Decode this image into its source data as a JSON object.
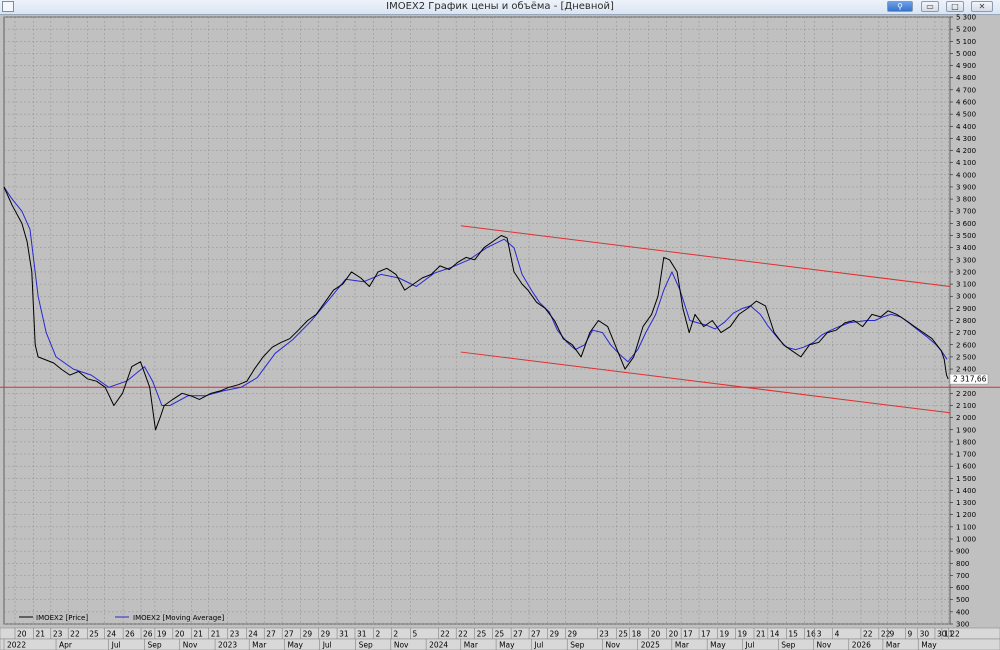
{
  "window": {
    "title": "IMOEX2 График цены и объёма - [Дневной]"
  },
  "colors": {
    "plot_bg": "#c0c0c0",
    "grid": "#8f8f8f",
    "price": "#000000",
    "moving_average": "#2828d0",
    "trendline": "#e03030",
    "support": "#e03030"
  },
  "chart_data": {
    "type": "line",
    "title": "",
    "xlabel": "",
    "ylabel": "",
    "ylim": [
      300,
      5300
    ],
    "y_tick_step": 100,
    "x_range": [
      "2022-01-01",
      "2026-06-25"
    ],
    "grid": true,
    "legend_position": "bottom-left",
    "legend": [
      {
        "name": "IMOEX2 [Price]",
        "color": "#000000"
      },
      {
        "name": "IMOEX2 [Moving Average]",
        "color": "#2828d0"
      }
    ],
    "last_price_label": "2 317,66",
    "x_day_ticks": [
      {
        "date": "2022-01-20",
        "label": "20"
      },
      {
        "date": "2022-02-21",
        "label": "21"
      },
      {
        "date": "2022-03-23",
        "label": "23"
      },
      {
        "date": "2022-04-22",
        "label": "22"
      },
      {
        "date": "2022-05-25",
        "label": "25"
      },
      {
        "date": "2022-06-24",
        "label": "24"
      },
      {
        "date": "2022-07-26",
        "label": "26"
      },
      {
        "date": "2022-08-26",
        "label": "26"
      },
      {
        "date": "2022-09-19",
        "label": "19"
      },
      {
        "date": "2022-10-20",
        "label": "20"
      },
      {
        "date": "2022-11-21",
        "label": "21"
      },
      {
        "date": "2022-12-21",
        "label": "21"
      },
      {
        "date": "2023-01-23",
        "label": "23"
      },
      {
        "date": "2023-02-24",
        "label": "24"
      },
      {
        "date": "2023-03-27",
        "label": "27"
      },
      {
        "date": "2023-04-27",
        "label": "27"
      },
      {
        "date": "2023-05-29",
        "label": "29"
      },
      {
        "date": "2023-06-29",
        "label": "29"
      },
      {
        "date": "2023-07-31",
        "label": "31"
      },
      {
        "date": "2023-08-31",
        "label": "31"
      },
      {
        "date": "2023-10-02",
        "label": "2"
      },
      {
        "date": "2023-11-02",
        "label": "2"
      },
      {
        "date": "2023-12-05",
        "label": "5"
      },
      {
        "date": "2024-01-22",
        "label": "22"
      },
      {
        "date": "2024-02-22",
        "label": "22"
      },
      {
        "date": "2024-03-25",
        "label": "25"
      },
      {
        "date": "2024-04-25",
        "label": "25"
      },
      {
        "date": "2024-05-27",
        "label": "27"
      },
      {
        "date": "2024-06-27",
        "label": "27"
      },
      {
        "date": "2024-07-29",
        "label": "29"
      },
      {
        "date": "2024-08-29",
        "label": "29"
      },
      {
        "date": "2024-10-23",
        "label": "23"
      },
      {
        "date": "2024-11-25",
        "label": "25"
      },
      {
        "date": "2024-12-18",
        "label": "18"
      },
      {
        "date": "2025-01-20",
        "label": "20"
      },
      {
        "date": "2025-02-20",
        "label": "20"
      },
      {
        "date": "2025-03-17",
        "label": "17"
      },
      {
        "date": "2025-04-17",
        "label": "17"
      },
      {
        "date": "2025-05-19",
        "label": "19"
      },
      {
        "date": "2025-06-19",
        "label": "19"
      },
      {
        "date": "2025-07-21",
        "label": "21"
      },
      {
        "date": "2025-08-14",
        "label": "14"
      },
      {
        "date": "2025-09-15",
        "label": "15"
      },
      {
        "date": "2025-10-16",
        "label": "16"
      },
      {
        "date": "2025-11-03",
        "label": "3"
      },
      {
        "date": "2025-12-04",
        "label": "4"
      },
      {
        "date": "2026-01-22",
        "label": "22"
      },
      {
        "date": "2026-02-22",
        "label": "22"
      },
      {
        "date": "2026-03-09",
        "label": "9"
      },
      {
        "date": "2026-04-09",
        "label": "9"
      },
      {
        "date": "2026-04-30",
        "label": "30"
      },
      {
        "date": "2026-05-30",
        "label": "30"
      },
      {
        "date": "2026-06-11",
        "label": "11"
      },
      {
        "date": "2026-06-22",
        "label": "22"
      }
    ],
    "x_month_ticks": [
      {
        "date": "2022-01-01",
        "label": "2022"
      },
      {
        "date": "2022-04-01",
        "label": "Apr"
      },
      {
        "date": "2022-07-01",
        "label": "Jul"
      },
      {
        "date": "2022-09-01",
        "label": "Sep"
      },
      {
        "date": "2022-11-01",
        "label": "Nov"
      },
      {
        "date": "2023-01-01",
        "label": "2023"
      },
      {
        "date": "2023-03-01",
        "label": "Mar"
      },
      {
        "date": "2023-05-01",
        "label": "May"
      },
      {
        "date": "2023-07-01",
        "label": "Jul"
      },
      {
        "date": "2023-09-01",
        "label": "Sep"
      },
      {
        "date": "2023-11-01",
        "label": "Nov"
      },
      {
        "date": "2024-01-01",
        "label": "2024"
      },
      {
        "date": "2024-03-01",
        "label": "Mar"
      },
      {
        "date": "2024-05-01",
        "label": "May"
      },
      {
        "date": "2024-07-01",
        "label": "Jul"
      },
      {
        "date": "2024-09-01",
        "label": "Sep"
      },
      {
        "date": "2024-11-01",
        "label": "Nov"
      },
      {
        "date": "2025-01-01",
        "label": "2025"
      },
      {
        "date": "2025-03-01",
        "label": "Mar"
      },
      {
        "date": "2025-05-01",
        "label": "May"
      },
      {
        "date": "2025-07-01",
        "label": "Jul"
      },
      {
        "date": "2025-09-01",
        "label": "Sep"
      },
      {
        "date": "2025-11-01",
        "label": "Nov"
      },
      {
        "date": "2026-01-01",
        "label": "2026"
      },
      {
        "date": "2026-03-01",
        "label": "Mar"
      },
      {
        "date": "2026-05-01",
        "label": "May"
      }
    ],
    "price": {
      "x": [
        "2022-01-01",
        "2022-01-15",
        "2022-02-01",
        "2022-02-10",
        "2022-02-18",
        "2022-02-24",
        "2022-03-01",
        "2022-03-28",
        "2022-04-10",
        "2022-04-25",
        "2022-05-10",
        "2022-05-25",
        "2022-06-10",
        "2022-06-25",
        "2022-07-10",
        "2022-07-25",
        "2022-08-10",
        "2022-08-25",
        "2022-09-10",
        "2022-09-20",
        "2022-09-28",
        "2022-10-05",
        "2022-10-20",
        "2022-11-05",
        "2022-11-20",
        "2022-12-05",
        "2022-12-25",
        "2023-01-10",
        "2023-01-25",
        "2023-02-10",
        "2023-02-25",
        "2023-03-10",
        "2023-03-25",
        "2023-04-10",
        "2023-04-25",
        "2023-05-10",
        "2023-05-25",
        "2023-06-10",
        "2023-06-25",
        "2023-07-10",
        "2023-07-25",
        "2023-08-10",
        "2023-08-25",
        "2023-09-10",
        "2023-09-25",
        "2023-10-10",
        "2023-10-25",
        "2023-11-10",
        "2023-11-25",
        "2023-12-10",
        "2023-12-25",
        "2024-01-10",
        "2024-01-25",
        "2024-02-10",
        "2024-02-25",
        "2024-03-10",
        "2024-03-25",
        "2024-04-10",
        "2024-04-25",
        "2024-05-10",
        "2024-05-20",
        "2024-06-01",
        "2024-06-15",
        "2024-06-25",
        "2024-07-10",
        "2024-07-25",
        "2024-08-10",
        "2024-08-25",
        "2024-09-10",
        "2024-09-25",
        "2024-10-10",
        "2024-10-25",
        "2024-11-10",
        "2024-11-27",
        "2024-12-10",
        "2024-12-25",
        "2025-01-10",
        "2025-01-25",
        "2025-02-05",
        "2025-02-15",
        "2025-02-25",
        "2025-03-10",
        "2025-03-20",
        "2025-03-31",
        "2025-04-10",
        "2025-04-25",
        "2025-05-10",
        "2025-05-25",
        "2025-06-10",
        "2025-06-25",
        "2025-07-10",
        "2025-07-25",
        "2025-08-10",
        "2025-08-25",
        "2025-09-10",
        "2025-09-25",
        "2025-10-10",
        "2025-10-25",
        "2025-11-10",
        "2025-11-25",
        "2025-12-10",
        "2025-12-25",
        "2026-01-10",
        "2026-01-25",
        "2026-02-10",
        "2026-02-25",
        "2026-03-10",
        "2026-03-25",
        "2026-04-10",
        "2026-04-25",
        "2026-05-10",
        "2026-05-25",
        "2026-06-10",
        "2026-06-15",
        "2026-06-19",
        "2026-06-22"
      ],
      "y": [
        3900,
        3750,
        3600,
        3450,
        3200,
        2600,
        2500,
        2450,
        2400,
        2350,
        2380,
        2320,
        2300,
        2250,
        2100,
        2200,
        2420,
        2460,
        2250,
        1900,
        2000,
        2100,
        2150,
        2200,
        2180,
        2150,
        2200,
        2220,
        2250,
        2270,
        2300,
        2400,
        2500,
        2580,
        2620,
        2650,
        2720,
        2800,
        2850,
        2950,
        3050,
        3100,
        3200,
        3150,
        3080,
        3200,
        3230,
        3180,
        3050,
        3100,
        3150,
        3180,
        3250,
        3220,
        3280,
        3320,
        3300,
        3400,
        3450,
        3500,
        3480,
        3200,
        3100,
        3050,
        2950,
        2900,
        2800,
        2650,
        2600,
        2500,
        2700,
        2800,
        2750,
        2550,
        2400,
        2500,
        2750,
        2850,
        3000,
        3320,
        3300,
        3200,
        2900,
        2700,
        2850,
        2750,
        2800,
        2700,
        2750,
        2850,
        2900,
        2960,
        2920,
        2700,
        2600,
        2550,
        2500,
        2600,
        2620,
        2700,
        2720,
        2780,
        2800,
        2750,
        2850,
        2830,
        2880,
        2850,
        2800,
        2750,
        2700,
        2650,
        2550,
        2480,
        2350,
        2317.66
      ]
    },
    "moving_average": {
      "x": [
        "2022-01-01",
        "2022-01-15",
        "2022-02-01",
        "2022-02-15",
        "2022-03-01",
        "2022-03-15",
        "2022-04-01",
        "2022-05-01",
        "2022-06-01",
        "2022-07-01",
        "2022-08-01",
        "2022-09-01",
        "2022-09-15",
        "2022-10-01",
        "2022-10-15",
        "2022-11-15",
        "2022-12-15",
        "2023-01-15",
        "2023-02-15",
        "2023-03-15",
        "2023-04-15",
        "2023-05-15",
        "2023-06-15",
        "2023-07-15",
        "2023-08-15",
        "2023-09-15",
        "2023-10-15",
        "2023-11-15",
        "2023-12-15",
        "2024-01-15",
        "2024-02-15",
        "2024-03-15",
        "2024-04-15",
        "2024-05-15",
        "2024-06-01",
        "2024-06-15",
        "2024-07-01",
        "2024-07-15",
        "2024-08-01",
        "2024-08-15",
        "2024-09-01",
        "2024-09-15",
        "2024-10-01",
        "2024-10-15",
        "2024-11-01",
        "2024-11-15",
        "2024-12-01",
        "2024-12-15",
        "2025-01-01",
        "2025-01-15",
        "2025-02-01",
        "2025-02-15",
        "2025-03-01",
        "2025-03-15",
        "2025-04-01",
        "2025-04-15",
        "2025-05-01",
        "2025-05-15",
        "2025-06-01",
        "2025-06-15",
        "2025-07-01",
        "2025-07-15",
        "2025-08-01",
        "2025-08-15",
        "2025-09-01",
        "2025-09-15",
        "2025-10-01",
        "2025-10-15",
        "2025-11-01",
        "2025-11-15",
        "2025-12-01",
        "2025-12-15",
        "2026-01-01",
        "2026-01-15",
        "2026-02-01",
        "2026-02-15",
        "2026-03-01",
        "2026-03-15",
        "2026-04-01",
        "2026-04-15",
        "2026-05-01",
        "2026-05-15",
        "2026-06-01",
        "2026-06-10",
        "2026-06-20"
      ],
      "y": [
        3900,
        3800,
        3700,
        3550,
        3000,
        2700,
        2500,
        2400,
        2350,
        2250,
        2300,
        2420,
        2300,
        2100,
        2100,
        2180,
        2180,
        2220,
        2250,
        2330,
        2530,
        2640,
        2790,
        2960,
        3140,
        3120,
        3180,
        3150,
        3080,
        3190,
        3240,
        3300,
        3400,
        3470,
        3400,
        3180,
        3050,
        2950,
        2870,
        2720,
        2620,
        2560,
        2600,
        2720,
        2700,
        2600,
        2520,
        2460,
        2560,
        2700,
        2850,
        3050,
        3200,
        3050,
        2800,
        2780,
        2760,
        2730,
        2790,
        2860,
        2900,
        2920,
        2850,
        2750,
        2650,
        2580,
        2560,
        2580,
        2620,
        2680,
        2720,
        2750,
        2780,
        2790,
        2800,
        2800,
        2830,
        2850,
        2830,
        2780,
        2720,
        2670,
        2600,
        2550,
        2480
      ]
    },
    "resistance_trendline": {
      "x": [
        "2024-03-01",
        "2026-06-25"
      ],
      "y": [
        3580,
        3080
      ]
    },
    "support_trendline": {
      "x": [
        "2024-03-01",
        "2026-06-25"
      ],
      "y": [
        2540,
        2040
      ]
    },
    "horizontal_level": {
      "y": 2250
    }
  }
}
